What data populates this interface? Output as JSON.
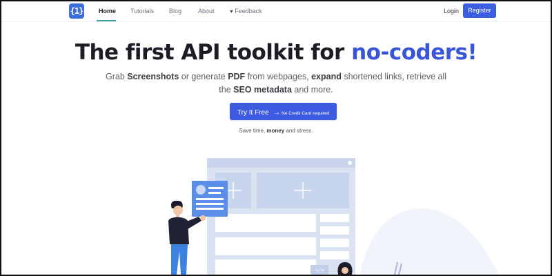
{
  "nav": {
    "logo_text": "{1}",
    "links": [
      {
        "label": "Home",
        "active": true
      },
      {
        "label": "Tutorials",
        "active": false
      },
      {
        "label": "Blog",
        "active": false
      },
      {
        "label": "About",
        "active": false
      },
      {
        "label": "Feedback",
        "active": false,
        "icon": "heart-icon"
      }
    ],
    "login_label": "Login",
    "register_label": "Register"
  },
  "hero": {
    "title_main": "The first API toolkit for ",
    "title_accent": "no-coders!",
    "subtitle_parts": [
      {
        "text": "Grab ",
        "bold": false
      },
      {
        "text": "Screenshots",
        "bold": true
      },
      {
        "text": " or generate ",
        "bold": false
      },
      {
        "text": "PDF",
        "bold": true
      },
      {
        "text": " from webpages, ",
        "bold": false
      },
      {
        "text": "expand",
        "bold": true
      },
      {
        "text": " shortened links, retrieve all the ",
        "bold": false
      },
      {
        "text": "SEO metadata",
        "bold": true
      },
      {
        "text": " and more.",
        "bold": false
      }
    ],
    "cta_label": "Try It Free",
    "cta_note": "No Credit Card required",
    "tagline_pre": "Save time, ",
    "tagline_bold": "money",
    "tagline_post": " and stress."
  },
  "illustration": {
    "code_tag": "</>"
  },
  "colors": {
    "accent": "#3a55d8",
    "button": "#3d5be0",
    "nav_underline": "#3ba4a0",
    "illustration_light": "#dde5f4",
    "illustration_mid": "#c7d4ee",
    "illustration_blue": "#5b8ee6"
  }
}
